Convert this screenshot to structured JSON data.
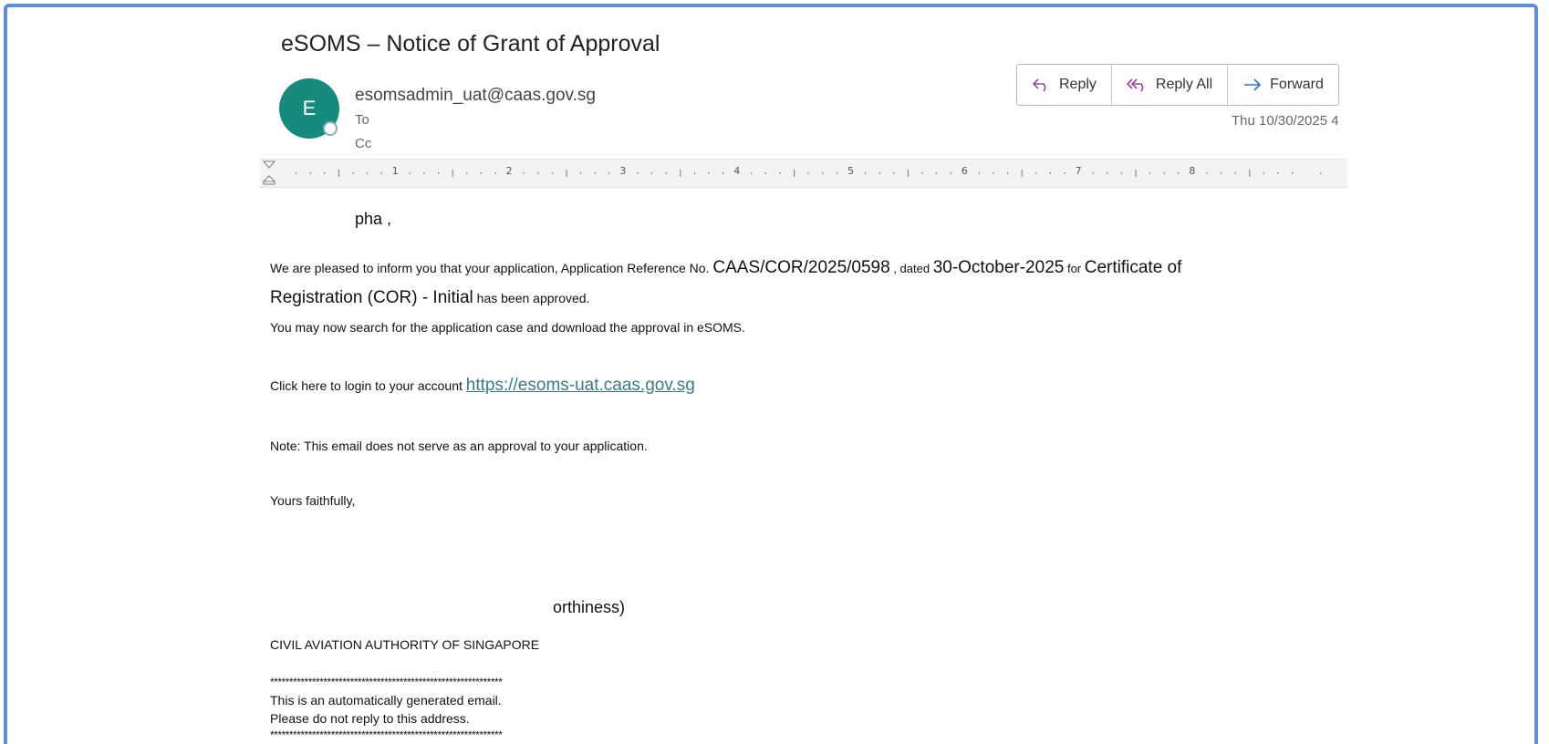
{
  "email": {
    "subject": "eSOMS – Notice of Grant of Approval",
    "avatar_initial": "E",
    "sender": "esomsadmin_uat@caas.gov.sg",
    "to_label": "To",
    "cc_label": "Cc",
    "datetime": "Thu 10/30/2025 4"
  },
  "actions": {
    "reply": "Reply",
    "reply_all": "Reply All",
    "forward": "Forward"
  },
  "ruler": {
    "numbers": [
      "1",
      "2",
      "3",
      "4",
      "5",
      "6",
      "7",
      "8"
    ]
  },
  "body": {
    "greeting_name": "pha ,",
    "p1_a": "We are pleased to inform you that your application, Application Reference No. ",
    "ref_no": "CAAS/COR/2025/0598",
    "p1_b": " , dated ",
    "date": "30-October-2025",
    "p1_c": " for ",
    "cert_line1": "Certificate of",
    "cert_line2": "Registration (COR) - Initial",
    "p1_d": " has been approved.",
    "p2": "You may now search for the application case and download the approval in eSOMS.",
    "p3_prefix": "Click here to login to your account ",
    "login_link": "https://esoms-uat.caas.gov.sg",
    "p4": "Note: This email does not serve as an approval to your application.",
    "closing": "Yours faithfully,",
    "dept_fragment": "orthiness)",
    "org": "CIVIL AVIATION AUTHORITY OF SINGAPORE",
    "stars": "*************************************************************",
    "auto_line1": "This is an automatically generated email.",
    "auto_line2": "Please do not reply to this address."
  },
  "colors": {
    "frame_border": "#5b8fd6",
    "avatar_bg": "#178a7e",
    "link": "#3a7a8c",
    "reply_all_icon": "#a03ea8",
    "forward_icon": "#2f6fd0"
  }
}
